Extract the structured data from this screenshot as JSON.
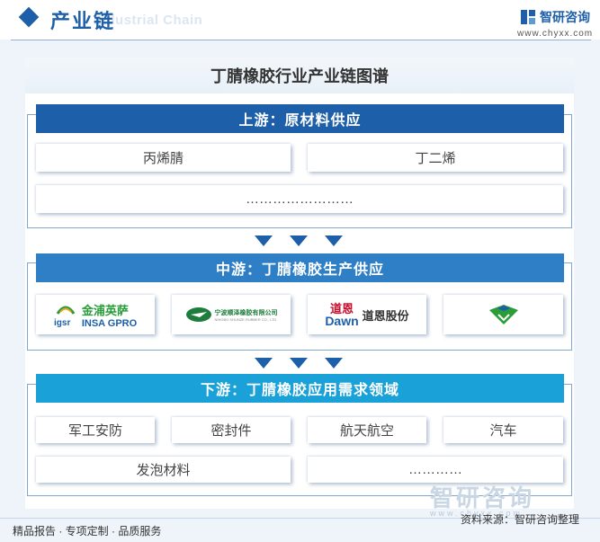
{
  "header": {
    "section_title": "产业链",
    "section_title_en": "Industrial Chain",
    "brand_name": "智研咨询",
    "brand_url": "www.chyxx.com"
  },
  "diagram": {
    "title": "丁腈橡胶行业产业链图谱",
    "upstream": {
      "heading": "上游：原材料供应",
      "items": [
        "丙烯腈",
        "丁二烯"
      ],
      "more": "……………………"
    },
    "midstream": {
      "heading": "中游：丁腈橡胶生产供应",
      "companies": [
        {
          "name_cn": "金浦英萨",
          "name_en": "INSA GPRO",
          "mark": "igsr"
        },
        {
          "name_cn": "宁波顺泽橡胶有限公司",
          "name_en": "NINGBO SHUNZE RUBBER CO., LTD"
        },
        {
          "name_cn": "道恩股份",
          "mark_cn": "道恩",
          "mark_en": "Dawn"
        },
        {
          "name_cn": ""
        }
      ]
    },
    "downstream": {
      "heading": "下游：丁腈橡胶应用需求领域",
      "items": [
        "军工安防",
        "密封件",
        "航天航空",
        "汽车",
        "发泡材料"
      ],
      "more": "…………"
    }
  },
  "footer": {
    "tagline": "精品报告 · 专项定制 · 品质服务",
    "source": "资料来源：智研咨询整理",
    "watermark": "智研咨询",
    "watermark_url": "www.chyxx.com"
  },
  "colors": {
    "primary": "#1d5fa8",
    "mid": "#2f7fc6",
    "down": "#1aa2d8",
    "background": "#eef4fa"
  }
}
